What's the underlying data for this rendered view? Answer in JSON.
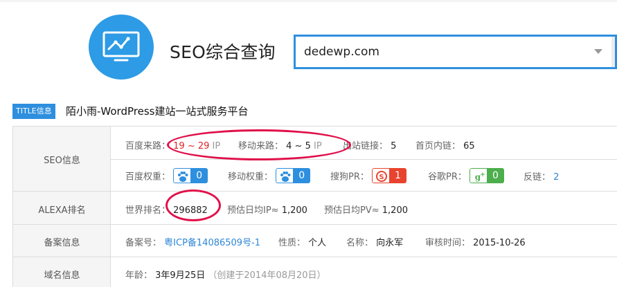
{
  "header": {
    "title": "SEO综合查询",
    "domain_value": "dedewp.com",
    "icons": {
      "logo": "monitor-chart-icon",
      "dropdown": "chevron-down-icon"
    },
    "accent": "#2d9be5"
  },
  "title_row": {
    "badge": "TITLE信息",
    "text": "陌小雨-WordPress建站一站式服务平台"
  },
  "seo": {
    "label": "SEO信息",
    "baidu_traffic_label": "百度来路：",
    "baidu_traffic_value": "19 ~ 29",
    "baidu_traffic_unit": "IP",
    "mobile_traffic_label": "移动来路：",
    "mobile_traffic_value": "4 ~ 5",
    "mobile_traffic_unit": "IP",
    "outlinks_label": "出站链接：",
    "outlinks_value": "5",
    "homepage_links_label": "首页内链：",
    "homepage_links_value": "65",
    "baidu_weight_label": "百度权重：",
    "baidu_weight_value": "0",
    "mobile_weight_label": "移动权重：",
    "mobile_weight_value": "0",
    "sogou_pr_label": "搜狗PR：",
    "sogou_pr_value": "1",
    "google_pr_label": "谷歌PR：",
    "google_pr_value": "0",
    "backlinks_label": "反链：",
    "backlinks_value": "2",
    "badge_colors": {
      "baidu": "#2d8fde",
      "sogou": "#e8432f",
      "google": "#4cae4c"
    }
  },
  "alexa": {
    "label": "ALEXA排名",
    "world_rank_label": "世界排名：",
    "world_rank_value": "296882",
    "daily_ip_label": "预估日均IP≈",
    "daily_ip_value": "1,200",
    "daily_pv_label": "预估日均PV≈",
    "daily_pv_value": "1,200"
  },
  "icp": {
    "label": "备案信息",
    "number_label": "备案号：",
    "number_value": "粤ICP备14086509号-1",
    "nature_label": "性质：",
    "nature_value": "个人",
    "name_label": "名称：",
    "name_value": "向永军",
    "review_label": "审核时间：",
    "review_value": "2015-10-26"
  },
  "domain_info": {
    "label": "域名信息",
    "age_label": "年龄：",
    "age_value": "3年9月25日",
    "created_note": "（创建于2014年08月20日）"
  }
}
